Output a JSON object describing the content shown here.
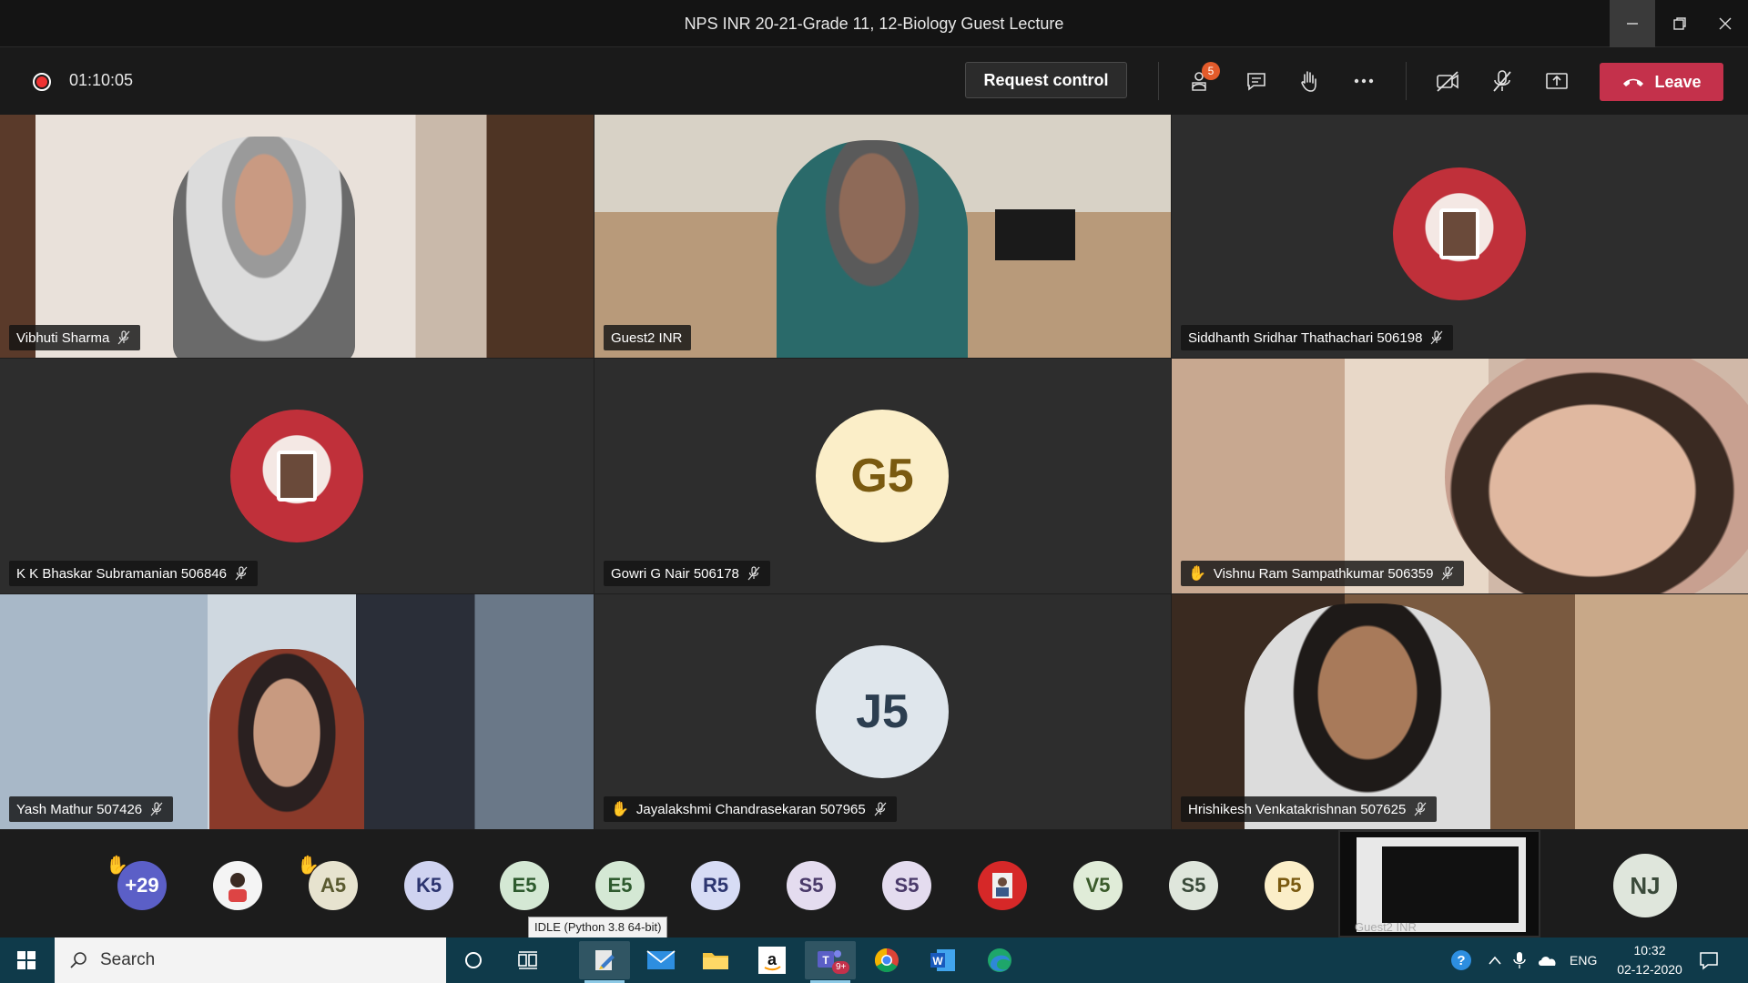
{
  "window": {
    "title": "NPS INR 20-21-Grade 11, 12-Biology Guest Lecture"
  },
  "toolbar": {
    "timer": "01:10:05",
    "request_control": "Request control",
    "participants_badge": "5",
    "leave": "Leave"
  },
  "tiles": [
    {
      "name": "Vibhuti Sharma"
    },
    {
      "name": "Guest2 INR"
    },
    {
      "name": "Siddhanth Sridhar Thathachari 506198"
    },
    {
      "name": "K K Bhaskar Subramanian 506846"
    },
    {
      "name": "Gowri G Nair 506178",
      "initials": "G5"
    },
    {
      "name": "Vishnu Ram Sampathkumar 506359"
    },
    {
      "name": "Yash Mathur 507426"
    },
    {
      "name": "Jayalakshmi Chandrasekaran 507965",
      "initials": "J5"
    },
    {
      "name": "Hrishikesh Venkatakrishnan 507625"
    }
  ],
  "strip": {
    "more_count": "+29",
    "avatars": [
      "A5",
      "K5",
      "E5",
      "E5",
      "R5",
      "S5",
      "S5",
      "V5",
      "S5",
      "P5"
    ],
    "share_caption": "Guest2 INR",
    "self_initials": "NJ"
  },
  "tooltip": "IDLE (Python 3.8 64-bit)",
  "taskbar": {
    "search_label": "Search",
    "teams_badge": "9+",
    "lang": "ENG",
    "time": "10:32",
    "date": "02-12-2020"
  },
  "colors": {
    "leave": "#c4314b",
    "taskbar": "#0f3a4a",
    "raised_hand": "#f0c020"
  }
}
